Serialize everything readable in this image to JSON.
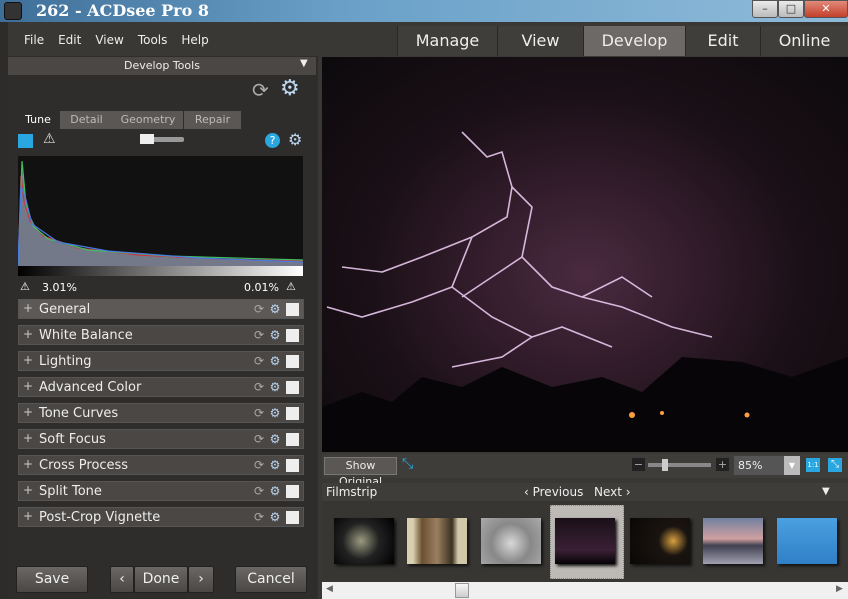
{
  "window": {
    "title": "262 - ACDsee Pro 8",
    "minimize": "–",
    "maximize": "□",
    "close": "✕"
  },
  "menu": [
    "File",
    "Edit",
    "View",
    "Tools",
    "Help"
  ],
  "modes": [
    "Manage",
    "View",
    "Develop",
    "Edit",
    "Online"
  ],
  "active_mode": "Develop",
  "panel": {
    "title": "Develop Tools",
    "tabs": [
      "Tune",
      "Detail",
      "Geometry",
      "Repair"
    ],
    "active_tab": "Tune",
    "shadow_clip": "3.01%",
    "highlight_clip": "0.01%",
    "sections": [
      "General",
      "White Balance",
      "Lighting",
      "Advanced Color",
      "Tone Curves",
      "Soft Focus",
      "Cross Process",
      "Split Tone",
      "Post-Crop Vignette"
    ]
  },
  "buttons": {
    "save": "Save",
    "prev": "‹",
    "done": "Done",
    "next": "›",
    "cancel": "Cancel"
  },
  "viewbar": {
    "show_original": "Show Original",
    "zoom": "85%",
    "zoom_minus": "−",
    "zoom_plus": "+",
    "one_to_one": "1:1"
  },
  "filmstrip": {
    "title": "Filmstrip",
    "previous": "‹ Previous",
    "next": "Next ›",
    "selected_index": 3
  },
  "colors": {
    "accent": "#2aa7e0",
    "active_mode": "#6c6966"
  }
}
